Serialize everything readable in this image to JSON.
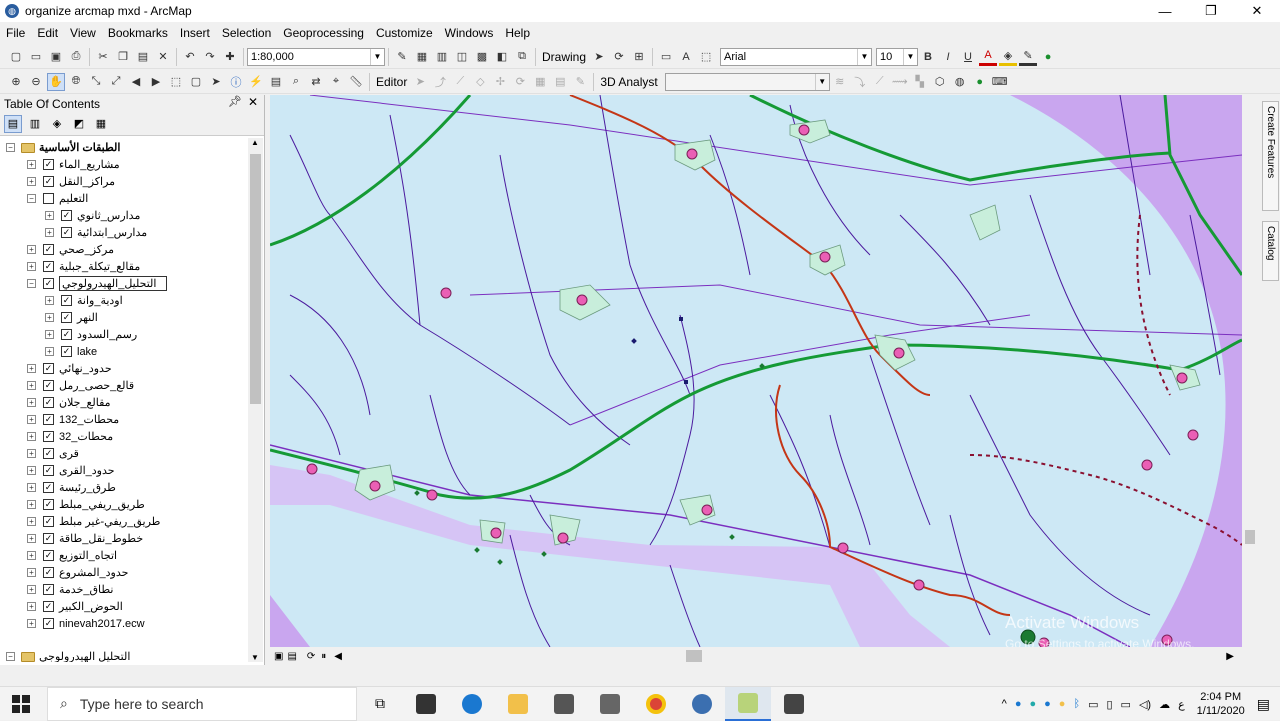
{
  "window": {
    "title": "organize arcmap mxd - ArcMap",
    "minimize": "—",
    "maximize": "❐",
    "close": "✕"
  },
  "menu": [
    "File",
    "Edit",
    "View",
    "Bookmarks",
    "Insert",
    "Selection",
    "Geoprocessing",
    "Customize",
    "Windows",
    "Help"
  ],
  "toolbar": {
    "scale": "1:80,000",
    "drawing_label": "Drawing",
    "font_name": "Arial",
    "font_size": "10",
    "bold": "B",
    "italic": "I",
    "underline": "U",
    "editor_label": "Editor",
    "analyst_label": "3D Analyst",
    "text_tool": "A"
  },
  "toc": {
    "title": "Table Of Contents",
    "root_group": "الطبقات الأساسية",
    "items": [
      {
        "label": "مشاريع_الماء",
        "indent": 1,
        "checked": true,
        "expand": "+"
      },
      {
        "label": "مراكز_النقل",
        "indent": 1,
        "checked": true,
        "expand": "+"
      },
      {
        "label": "التعليم",
        "indent": 1,
        "checked": false,
        "expand": "−"
      },
      {
        "label": "مدارس_ثانوي",
        "indent": 2,
        "checked": true,
        "expand": "+"
      },
      {
        "label": "مدارس_ابتدائية",
        "indent": 2,
        "checked": true,
        "expand": "+"
      },
      {
        "label": "مركز_صحي",
        "indent": 1,
        "checked": true,
        "expand": "+"
      },
      {
        "label": "مقالع_تيكلة_جبلية",
        "indent": 1,
        "checked": true,
        "expand": "+"
      },
      {
        "label": "التحليل_الهيدرولوجي",
        "indent": 1,
        "checked": true,
        "expand": "−",
        "editing": true
      },
      {
        "label": "اودية_وانة",
        "indent": 2,
        "checked": true,
        "expand": "+"
      },
      {
        "label": "النهر",
        "indent": 2,
        "checked": true,
        "expand": "+"
      },
      {
        "label": "رسم_السدود",
        "indent": 2,
        "checked": true,
        "expand": "+"
      },
      {
        "label": "lake",
        "indent": 2,
        "checked": true,
        "expand": "+"
      },
      {
        "label": "حدود_نهائي",
        "indent": 1,
        "checked": true,
        "expand": "+"
      },
      {
        "label": "قالع_حصى_رمل",
        "indent": 1,
        "checked": true,
        "expand": "+"
      },
      {
        "label": "مقالع_جلان",
        "indent": 1,
        "checked": true,
        "expand": "+"
      },
      {
        "label": "محطات_132",
        "indent": 1,
        "checked": true,
        "expand": "+"
      },
      {
        "label": "محطات_32",
        "indent": 1,
        "checked": true,
        "expand": "+"
      },
      {
        "label": "قرى",
        "indent": 1,
        "checked": true,
        "expand": "+"
      },
      {
        "label": "حدود_القرى",
        "indent": 1,
        "checked": true,
        "expand": "+"
      },
      {
        "label": "طرق_رئيسة",
        "indent": 1,
        "checked": true,
        "expand": "+"
      },
      {
        "label": "طريق_ريفي_مبلط",
        "indent": 1,
        "checked": true,
        "expand": "+"
      },
      {
        "label": "طريق_ريفي-غير مبلط",
        "indent": 1,
        "checked": true,
        "expand": "+"
      },
      {
        "label": "خطوط_نقل_طاقة",
        "indent": 1,
        "checked": true,
        "expand": "+"
      },
      {
        "label": "اتجاه_التوزيع",
        "indent": 1,
        "checked": true,
        "expand": "+"
      },
      {
        "label": "حدود_المشروع",
        "indent": 1,
        "checked": true,
        "expand": "+"
      },
      {
        "label": "نطاق_خدمة",
        "indent": 1,
        "checked": true,
        "expand": "+"
      },
      {
        "label": "الحوض_الكبير",
        "indent": 1,
        "checked": true,
        "expand": "+"
      },
      {
        "label": "ninevah2017.ecw",
        "indent": 1,
        "checked": true,
        "expand": "+"
      }
    ],
    "second_group": "التحليل الهيدرولوجي"
  },
  "right_dock": [
    "Create Features",
    "Catalog"
  ],
  "watermark": "Activate Windows",
  "watermark_sub": "Go to Settings to activate Windows.",
  "taskbar": {
    "search_placeholder": "Type here to search",
    "time": "2:04 PM",
    "date": "1/11/2020",
    "lang": "ع"
  },
  "colors": {
    "water": "#cde8f5",
    "purple_zone": "#c9a6ef",
    "stream": "#4b1a9e",
    "road": "#159a35",
    "river": "#c43616",
    "village": "#ea5fb5"
  }
}
